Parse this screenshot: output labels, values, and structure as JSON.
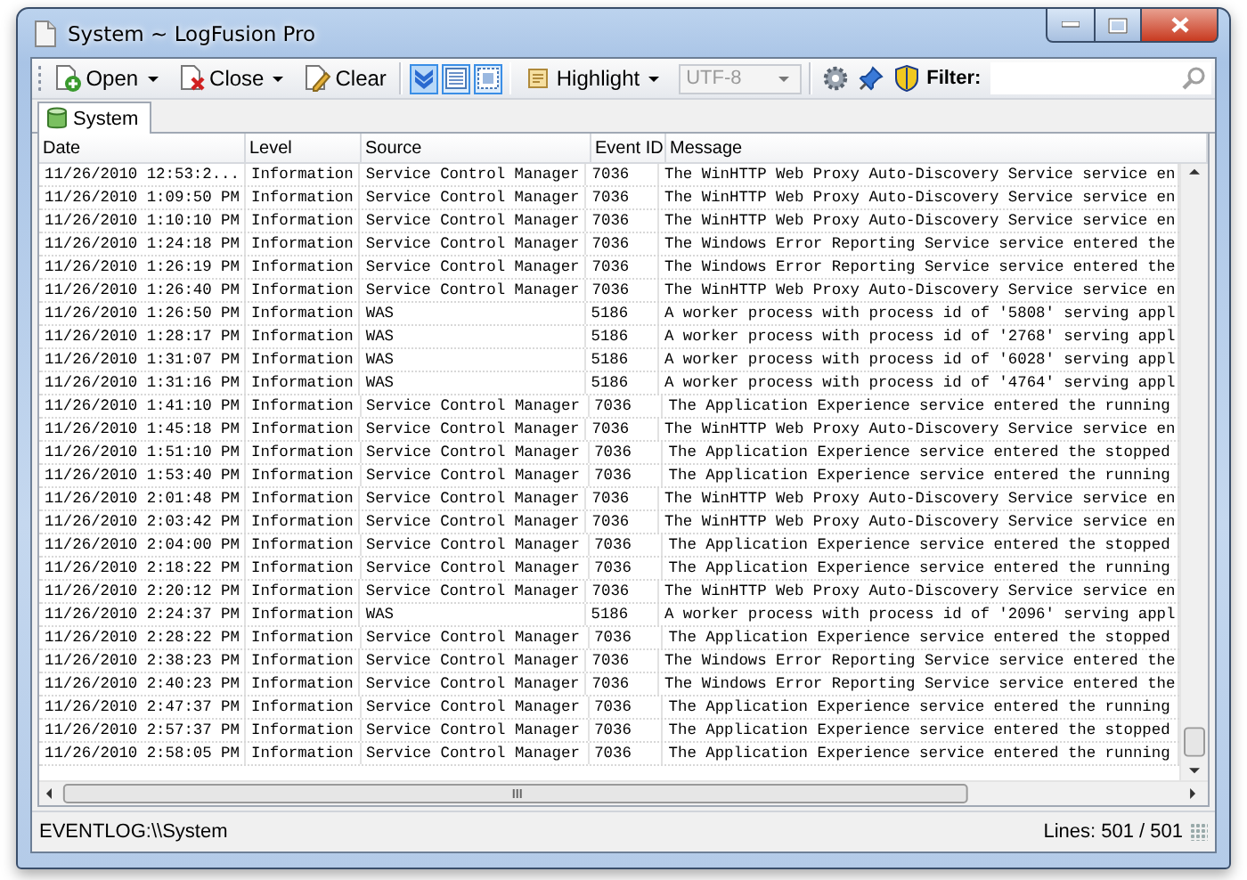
{
  "window": {
    "title": "System ~ LogFusion Pro"
  },
  "toolbar": {
    "items": [
      {
        "kind": "button",
        "label": "Open",
        "dropdown": true
      },
      {
        "kind": "button",
        "label": "Close",
        "dropdown": true
      },
      {
        "kind": "button",
        "label": "Clear",
        "dropdown": false
      },
      {
        "kind": "separator"
      },
      {
        "kind": "toggle",
        "pressed": true
      },
      {
        "kind": "toggle",
        "pressed": true
      },
      {
        "kind": "toggle",
        "pressed": true
      },
      {
        "kind": "separator"
      },
      {
        "kind": "button",
        "label": "Highlight",
        "dropdown": true
      },
      {
        "kind": "combo",
        "value": "UTF-8",
        "disabled": true
      },
      {
        "kind": "separator"
      },
      {
        "kind": "icon"
      },
      {
        "kind": "icon"
      },
      {
        "kind": "icon"
      }
    ],
    "filter": {
      "label": "Filter:"
    }
  },
  "tabs": [
    {
      "label": "System",
      "selected": true
    }
  ],
  "table": {
    "columns": [
      "Date",
      "Level",
      "Source",
      "Event ID",
      "Message"
    ],
    "rows": [
      [
        "11/26/2010 12:53:2...",
        "Information",
        "Service Control Manager",
        "7036",
        "The WinHTTP Web Proxy Auto-Discovery Service service en"
      ],
      [
        "11/26/2010 1:09:50 PM",
        "Information",
        "Service Control Manager",
        "7036",
        "The WinHTTP Web Proxy Auto-Discovery Service service en"
      ],
      [
        "11/26/2010 1:10:10 PM",
        "Information",
        "Service Control Manager",
        "7036",
        "The WinHTTP Web Proxy Auto-Discovery Service service en"
      ],
      [
        "11/26/2010 1:24:18 PM",
        "Information",
        "Service Control Manager",
        "7036",
        "The Windows Error Reporting Service service entered the"
      ],
      [
        "11/26/2010 1:26:19 PM",
        "Information",
        "Service Control Manager",
        "7036",
        "The Windows Error Reporting Service service entered the"
      ],
      [
        "11/26/2010 1:26:40 PM",
        "Information",
        "Service Control Manager",
        "7036",
        "The WinHTTP Web Proxy Auto-Discovery Service service en"
      ],
      [
        "11/26/2010 1:26:50 PM",
        "Information",
        "WAS",
        "5186",
        "A worker process with process id of '5808' serving appl"
      ],
      [
        "11/26/2010 1:28:17 PM",
        "Information",
        "WAS",
        "5186",
        "A worker process with process id of '2768' serving appl"
      ],
      [
        "11/26/2010 1:31:07 PM",
        "Information",
        "WAS",
        "5186",
        "A worker process with process id of '6028' serving appl"
      ],
      [
        "11/26/2010 1:31:16 PM",
        "Information",
        "WAS",
        "5186",
        "A worker process with process id of '4764' serving appl"
      ],
      [
        "11/26/2010 1:41:10 PM",
        "Information",
        "Service Control Manager",
        "7036",
        "The Application Experience service entered the running"
      ],
      [
        "11/26/2010 1:45:18 PM",
        "Information",
        "Service Control Manager",
        "7036",
        "The WinHTTP Web Proxy Auto-Discovery Service service en"
      ],
      [
        "11/26/2010 1:51:10 PM",
        "Information",
        "Service Control Manager",
        "7036",
        "The Application Experience service entered the stopped"
      ],
      [
        "11/26/2010 1:53:40 PM",
        "Information",
        "Service Control Manager",
        "7036",
        "The Application Experience service entered the running"
      ],
      [
        "11/26/2010 2:01:48 PM",
        "Information",
        "Service Control Manager",
        "7036",
        "The WinHTTP Web Proxy Auto-Discovery Service service en"
      ],
      [
        "11/26/2010 2:03:42 PM",
        "Information",
        "Service Control Manager",
        "7036",
        "The WinHTTP Web Proxy Auto-Discovery Service service en"
      ],
      [
        "11/26/2010 2:04:00 PM",
        "Information",
        "Service Control Manager",
        "7036",
        "The Application Experience service entered the stopped"
      ],
      [
        "11/26/2010 2:18:22 PM",
        "Information",
        "Service Control Manager",
        "7036",
        "The Application Experience service entered the running"
      ],
      [
        "11/26/2010 2:20:12 PM",
        "Information",
        "Service Control Manager",
        "7036",
        "The WinHTTP Web Proxy Auto-Discovery Service service en"
      ],
      [
        "11/26/2010 2:24:37 PM",
        "Information",
        "WAS",
        "5186",
        "A worker process with process id of '2096' serving appl"
      ],
      [
        "11/26/2010 2:28:22 PM",
        "Information",
        "Service Control Manager",
        "7036",
        "The Application Experience service entered the stopped"
      ],
      [
        "11/26/2010 2:38:23 PM",
        "Information",
        "Service Control Manager",
        "7036",
        "The Windows Error Reporting Service service entered the"
      ],
      [
        "11/26/2010 2:40:23 PM",
        "Information",
        "Service Control Manager",
        "7036",
        "The Windows Error Reporting Service service entered the"
      ],
      [
        "11/26/2010 2:47:37 PM",
        "Information",
        "Service Control Manager",
        "7036",
        "The Application Experience service entered the running"
      ],
      [
        "11/26/2010 2:57:37 PM",
        "Information",
        "Service Control Manager",
        "7036",
        "The Application Experience service entered the stopped"
      ],
      [
        "11/26/2010 2:58:05 PM",
        "Information",
        "Service Control Manager",
        "7036",
        "The Application Experience service entered the running"
      ]
    ]
  },
  "status_bar": {
    "left": "EVENTLOG:\\\\System",
    "right": "Lines: 501 / 501"
  }
}
